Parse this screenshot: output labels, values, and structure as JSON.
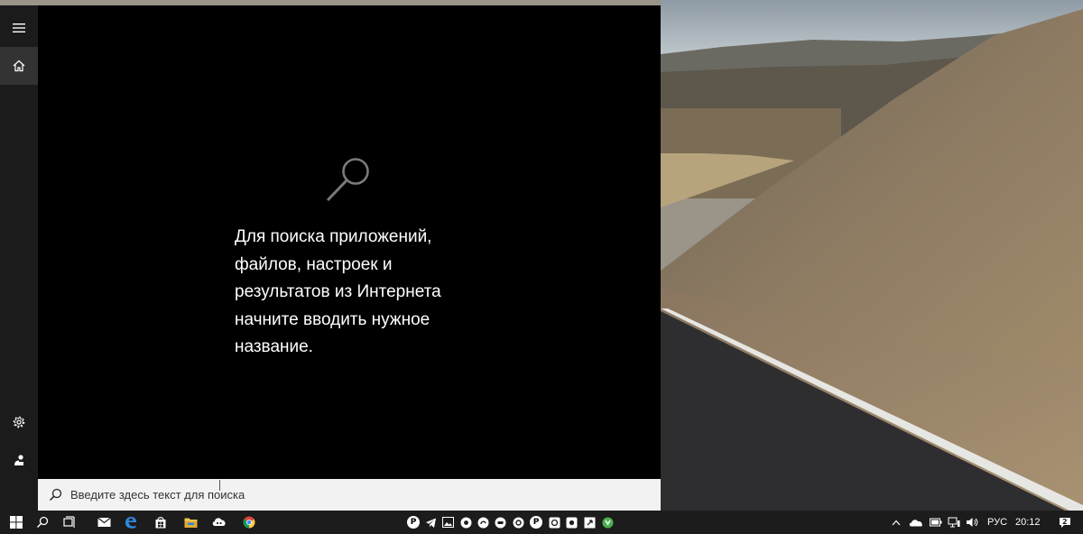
{
  "search_panel": {
    "hint_lines": [
      "Для поиска приложений,",
      "файлов, настроек и",
      "результатов из Интернета",
      "начните вводить нужное",
      "название."
    ],
    "search_placeholder": "Введите здесь текст для поиска"
  },
  "rail": {
    "items": [
      {
        "icon": "hamburger-menu-icon"
      },
      {
        "icon": "home-icon",
        "active": true
      },
      {
        "icon": "gear-icon"
      },
      {
        "icon": "feedback-icon"
      }
    ]
  },
  "taskbar": {
    "pinned": [
      "windows-start-icon",
      "search-icon",
      "task-view-icon",
      "mail-icon",
      "edge-icon",
      "store-icon",
      "file-explorer-icon",
      "photos-icon",
      "chrome-icon"
    ],
    "tray_apps": [
      "p-icon",
      "telegram-icon",
      "image-icon",
      "chrome-icon",
      "cloud-icon",
      "circle-icon",
      "settings-icon",
      "p-round-icon",
      "play-icon",
      "camera-icon",
      "media-icon",
      "green-app-icon"
    ],
    "system_tray": [
      "chevron-up-icon",
      "onedrive-icon",
      "battery-icon",
      "network-icon",
      "volume-icon"
    ],
    "language": "РУС",
    "clock": "20:12",
    "notifications_badge": "2"
  },
  "colors": {
    "panel_bg": "#000000",
    "rail_bg": "#1b1b1b",
    "searchbar_bg": "#f2f2f2",
    "taskbar_bg": "#1c1c1c"
  }
}
